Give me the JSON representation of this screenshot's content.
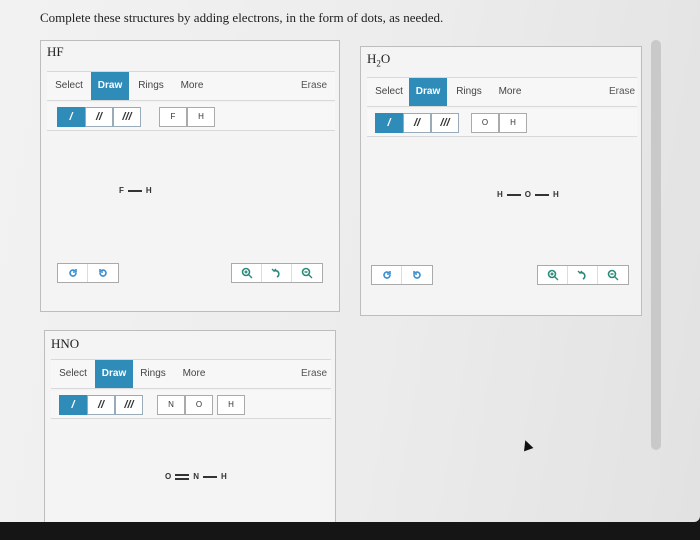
{
  "instruction": "Complete these structures by adding electrons, in the form of dots, as needed.",
  "panels": [
    {
      "title": "HF",
      "tabs": {
        "select": "Select",
        "draw": "Draw",
        "rings": "Rings",
        "more": "More",
        "erase": "Erase"
      },
      "bonds": {
        "single": "/",
        "double": "//",
        "triple": "///"
      },
      "atoms": [
        "F",
        "H"
      ],
      "molecule": {
        "a1": "F",
        "a2": "H"
      }
    },
    {
      "title_main": "H",
      "title_sub": "2",
      "title_end": "O",
      "tabs": {
        "select": "Select",
        "draw": "Draw",
        "rings": "Rings",
        "more": "More",
        "erase": "Erase"
      },
      "bonds": {
        "single": "/",
        "double": "//",
        "triple": "///"
      },
      "atoms": [
        "O",
        "H"
      ],
      "molecule": {
        "a1": "H",
        "a2": "O",
        "a3": "H"
      }
    },
    {
      "title": "HNO",
      "tabs": {
        "select": "Select",
        "draw": "Draw",
        "rings": "Rings",
        "more": "More",
        "erase": "Erase"
      },
      "bonds": {
        "single": "/",
        "double": "//",
        "triple": "///"
      },
      "atoms": [
        "N",
        "O",
        "H"
      ],
      "molecule": {
        "a1": "O",
        "a2": "N",
        "a3": "H"
      }
    }
  ],
  "colors": {
    "accent": "#2f8bb8",
    "undo": "#3a8fd0",
    "zoom": "#2a8a7a"
  },
  "icons": [
    "undo-icon",
    "redo-icon",
    "zoom-in-icon",
    "zoom-reset-icon",
    "zoom-out-icon",
    "mouse-cursor-icon"
  ]
}
